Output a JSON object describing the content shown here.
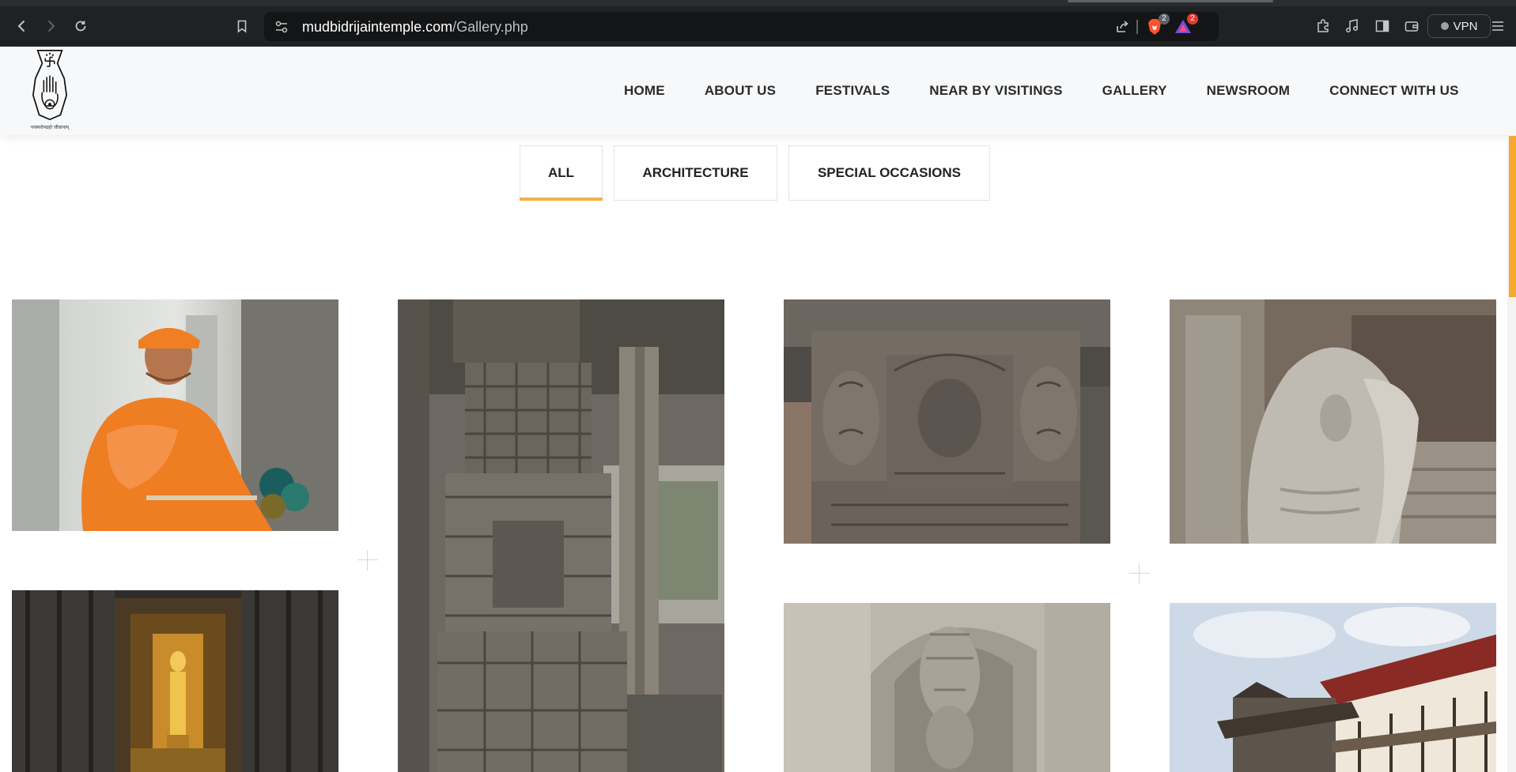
{
  "browser": {
    "url_host": "mudbidrijaintemple.com",
    "url_path": "/Gallery.php",
    "shields_badge": "2",
    "rewards_badge": "2",
    "vpn_label": "VPN"
  },
  "site": {
    "logo_caption": "परस्परोपग्रहो जीवानाम्",
    "nav": {
      "home": "HOME",
      "about": "ABOUT US",
      "festivals": "FESTIVALS",
      "near_by": "NEAR BY VISITINGS",
      "gallery": "GALLERY",
      "newsroom": "NEWSROOM",
      "connect": "CONNECT WITH US"
    }
  },
  "filters": {
    "all": "ALL",
    "architecture": "ARCHITECTURE",
    "special_occasions": "SPECIAL OCCASIONS",
    "active": "all"
  },
  "colors": {
    "accent": "#f2b14a",
    "scroll_thumb": "#f6a72e",
    "chrome_bg": "#202124",
    "header_bg": "#f7f8fa"
  }
}
